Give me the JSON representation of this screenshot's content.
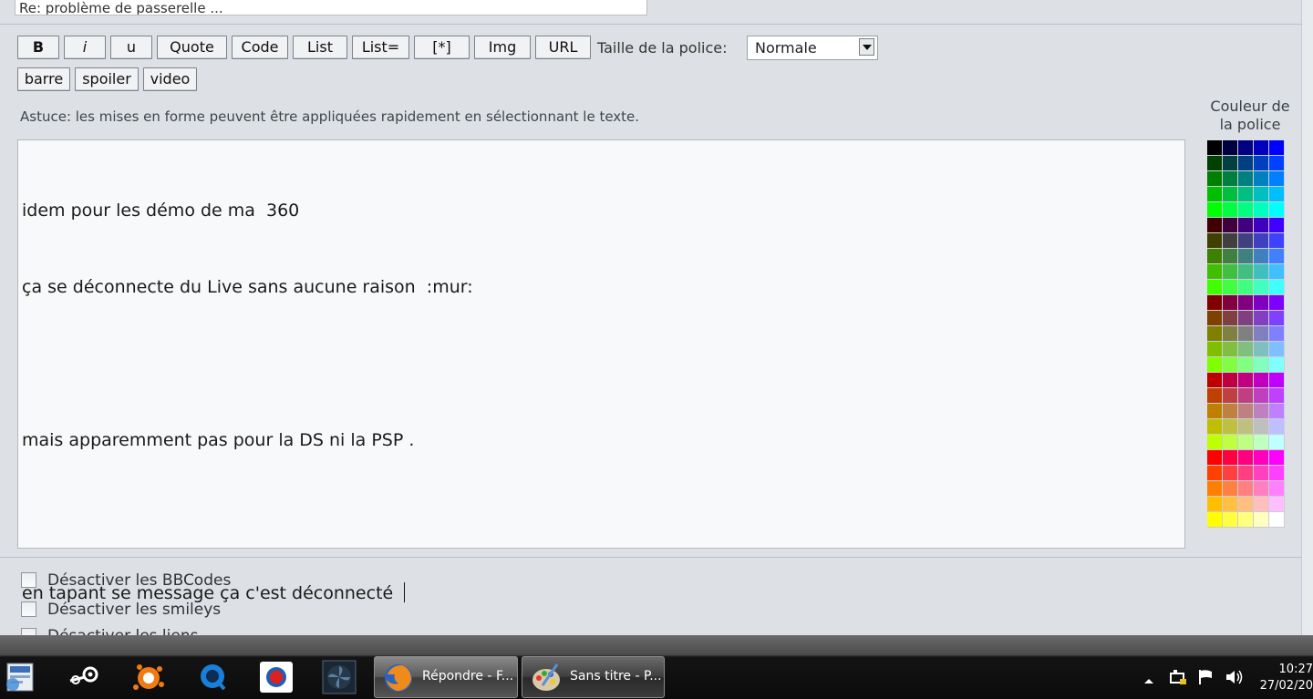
{
  "subject": {
    "value": "Re: problème de passerelle ..."
  },
  "toolbar": {
    "buttons": [
      "B",
      "i",
      "u",
      "Quote",
      "Code",
      "List",
      "List=",
      "[*]",
      "Img",
      "URL"
    ],
    "buttons_row2": [
      "barre",
      "spoiler",
      "video"
    ],
    "font_size_label": "Taille de la police:",
    "font_size_value": "Normale"
  },
  "hint": "Astuce: les mises en forme peuvent être appliquées rapidement en sélectionnant le texte.",
  "color_panel": {
    "title_line1": "Couleur de",
    "title_line2": "la police",
    "colors": [
      "#000000",
      "#000040",
      "#000080",
      "#0000bf",
      "#0000ff",
      "#004000",
      "#004040",
      "#004080",
      "#0040bf",
      "#0040ff",
      "#008000",
      "#008040",
      "#008080",
      "#0080bf",
      "#0080ff",
      "#00bf00",
      "#00bf40",
      "#00bf80",
      "#00bfbf",
      "#00bfff",
      "#00ff00",
      "#00ff40",
      "#00ff80",
      "#00ffbf",
      "#00ffff",
      "#400000",
      "#400040",
      "#400080",
      "#4000bf",
      "#4000ff",
      "#404000",
      "#404040",
      "#404080",
      "#4040bf",
      "#4040ff",
      "#408000",
      "#408040",
      "#408080",
      "#4080bf",
      "#4080ff",
      "#40bf00",
      "#40bf40",
      "#40bf80",
      "#40bfbf",
      "#40bfff",
      "#40ff00",
      "#40ff40",
      "#40ff80",
      "#40ffbf",
      "#40ffff",
      "#800000",
      "#800040",
      "#800080",
      "#8000bf",
      "#8000ff",
      "#804000",
      "#804040",
      "#804080",
      "#8040bf",
      "#8040ff",
      "#808000",
      "#808040",
      "#808080",
      "#8080bf",
      "#8080ff",
      "#80bf00",
      "#80bf40",
      "#80bf80",
      "#80bfbf",
      "#80bfff",
      "#80ff00",
      "#80ff40",
      "#80ff80",
      "#80ffbf",
      "#80ffff",
      "#bf0000",
      "#bf0040",
      "#bf0080",
      "#bf00bf",
      "#bf00ff",
      "#bf4000",
      "#bf4040",
      "#bf4080",
      "#bf40bf",
      "#bf40ff",
      "#bf8000",
      "#bf8040",
      "#bf8080",
      "#bf80bf",
      "#bf80ff",
      "#bfbf00",
      "#bfbf40",
      "#bfbf80",
      "#bfbfbf",
      "#bfbfff",
      "#bfff00",
      "#bfff40",
      "#bfff80",
      "#bfffbf",
      "#bfffff",
      "#ff0000",
      "#ff0040",
      "#ff0080",
      "#ff00bf",
      "#ff00ff",
      "#ff4000",
      "#ff4040",
      "#ff4080",
      "#ff40bf",
      "#ff40ff",
      "#ff8000",
      "#ff8040",
      "#ff8080",
      "#ff80bf",
      "#ff80ff",
      "#ffbf00",
      "#ffbf40",
      "#ffbf80",
      "#ffbfbf",
      "#ffbfff",
      "#ffff00",
      "#ffff40",
      "#ffff80",
      "#ffffbf",
      "#ffffff"
    ]
  },
  "message": {
    "lines": [
      "idem pour les démo de ma  360",
      "ça se déconnecte du Live sans aucune raison  :mur:",
      "",
      "mais apparemment pas pour la DS ni la PSP .",
      "",
      "en tapant se message ça c'est déconnecté "
    ]
  },
  "options": {
    "disable_bbcodes": "Désactiver les BBCodes",
    "disable_smileys": "Désactiver les smileys",
    "disable_links_partial": "Désactiver les liens"
  },
  "taskbar": {
    "icons": [
      "start-orb-icon",
      "steam-icon",
      "avast-icon",
      "quicktime-icon",
      "red-cross-app-icon",
      "fan-app-icon"
    ],
    "tasks": [
      {
        "label": "Répondre - F...",
        "icon": "firefox-icon"
      },
      {
        "label": "Sans titre - P...",
        "icon": "paint-icon"
      }
    ],
    "clock_time": "10:27",
    "clock_date": "27/02/20"
  }
}
